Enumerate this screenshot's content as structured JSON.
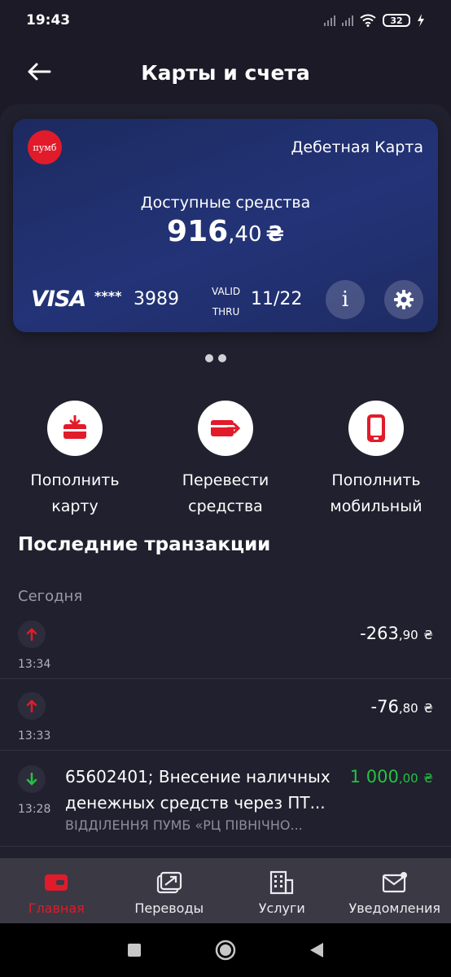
{
  "status_bar": {
    "time": "19:43",
    "battery": "32"
  },
  "header": {
    "title": "Карты и счета"
  },
  "card": {
    "bank_logo_text": "пумб",
    "type": "Дебетная Карта",
    "available_label": "Доступные средства",
    "balance_int": "916",
    "balance_dec": ",40",
    "currency": "₴",
    "network": "VISA",
    "masked": "****",
    "last4": "3989",
    "valid_label_1": "VALID",
    "valid_label_2": "THRU",
    "expiry": "11/22",
    "info_label": "i"
  },
  "actions": [
    {
      "label": "Пополнить\nкарту"
    },
    {
      "label": "Перевести\nсредства"
    },
    {
      "label": "Пополнить\nмобильный"
    }
  ],
  "transactions_title": "Последние транзакции",
  "date_group": "Сегодня",
  "transactions": [
    {
      "time": "13:34",
      "amount_int": "-263",
      "amount_dec": ",90",
      "currency": "₴",
      "direction": "out"
    },
    {
      "time": "13:33",
      "amount_int": "-76",
      "amount_dec": ",80",
      "currency": "₴",
      "direction": "out"
    },
    {
      "time": "13:28",
      "amount_int": "1 000",
      "amount_dec": ",00",
      "currency": "₴",
      "direction": "in",
      "description": "65602401; Внесение наличных денежных средств через  ПТ...",
      "sub": "ВІДДІЛЕННЯ ПУМБ «РЦ ПІВНІЧНО..."
    }
  ],
  "bottom_nav": [
    {
      "label": "Главная",
      "icon": "wallet-icon",
      "active": true
    },
    {
      "label": "Переводы",
      "icon": "transfer-icon"
    },
    {
      "label": "Услуги",
      "icon": "building-icon"
    },
    {
      "label": "Уведомления",
      "icon": "mail-icon"
    }
  ],
  "colors": {
    "accent": "#e11b2a",
    "positive": "#22c340",
    "background": "#1b1a26",
    "card": "#233377"
  }
}
